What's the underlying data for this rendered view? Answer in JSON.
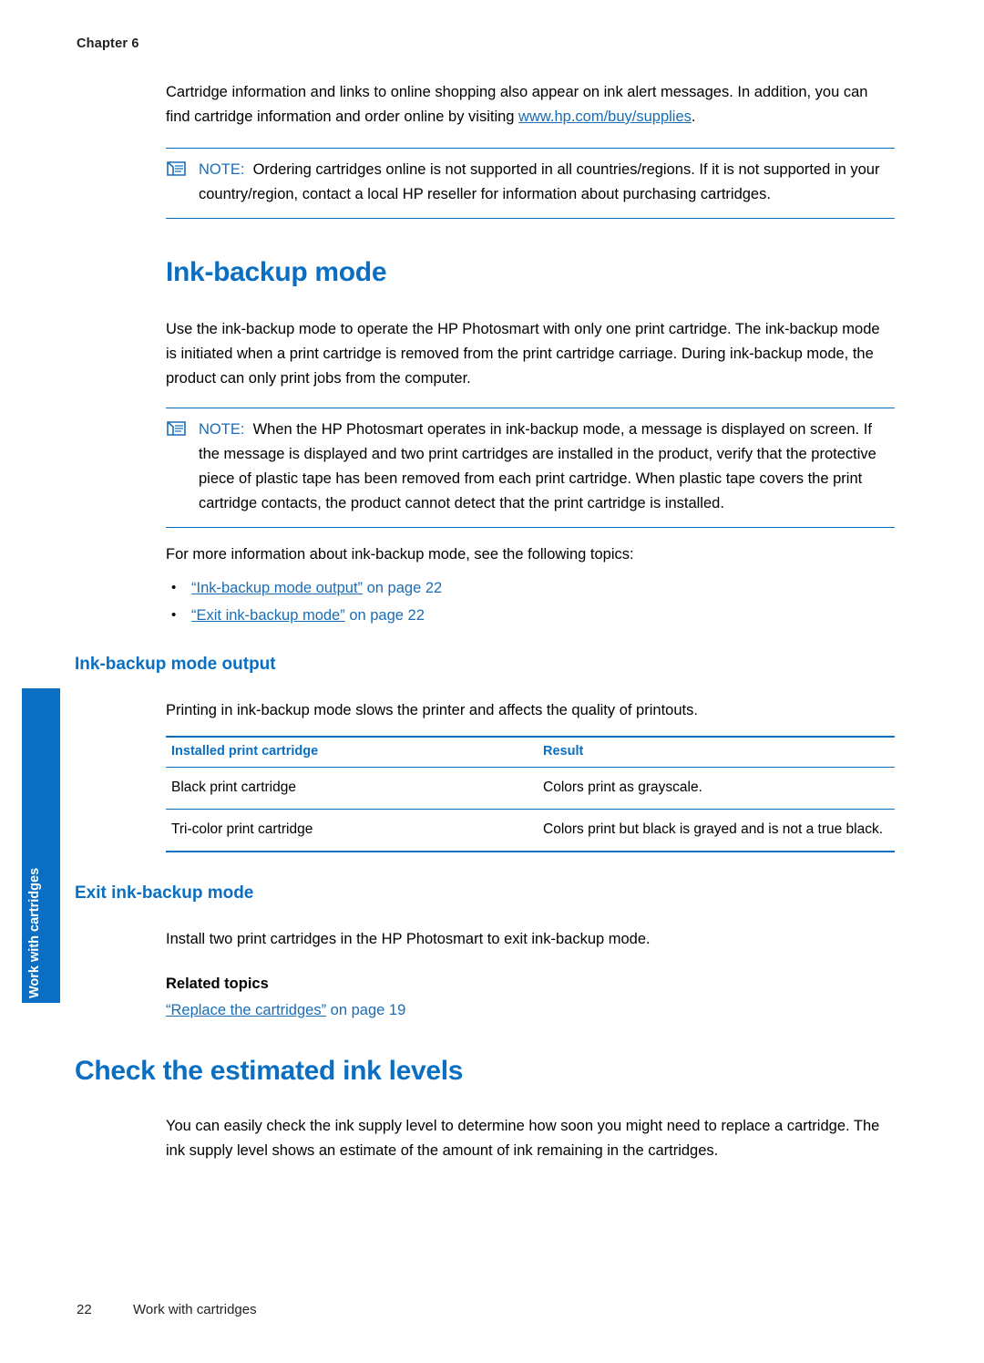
{
  "header": {
    "chapter_label": "Chapter 6"
  },
  "side_tab": {
    "label": "Work with cartridges",
    "color": "#0a6fc2"
  },
  "intro": {
    "paragraph_part1": "Cartridge information and links to online shopping also appear on ink alert messages. In addition, you can find cartridge information and order online by visiting ",
    "link_text": "www.hp.com/buy/supplies",
    "paragraph_part2": "."
  },
  "note1": {
    "keyword": "NOTE:",
    "text": "Ordering cartridges online is not supported in all countries/regions. If it is not supported in your country/region, contact a local HP reseller for information about purchasing cartridges."
  },
  "section1": {
    "title": "Ink-backup mode",
    "paragraph": "Use the ink-backup mode to operate the HP Photosmart with only one print cartridge. The ink-backup mode is initiated when a print cartridge is removed from the print cartridge carriage. During ink-backup mode, the product can only print jobs from the computer.",
    "note": {
      "keyword": "NOTE:",
      "text": "When the HP Photosmart operates in ink-backup mode, a message is displayed on screen. If the message is displayed and two print cartridges are installed in the product, verify that the protective piece of plastic tape has been removed from each print cartridge. When plastic tape covers the print cartridge contacts, the product cannot detect that the print cartridge is installed."
    },
    "more_info": "For more information about ink-backup mode, see the following topics:",
    "links": [
      {
        "quoted": "“Ink-backup mode output”",
        "suffix": " on page 22"
      },
      {
        "quoted": "“Exit ink-backup mode”",
        "suffix": " on page 22"
      }
    ]
  },
  "subsection_output": {
    "title": "Ink-backup mode output",
    "paragraph": "Printing in ink-backup mode slows the printer and affects the quality of printouts.",
    "table": {
      "headers": [
        "Installed print cartridge",
        "Result"
      ],
      "rows": [
        [
          "Black print cartridge",
          "Colors print as grayscale."
        ],
        [
          "Tri-color print cartridge",
          "Colors print but black is grayed and is not a true black."
        ]
      ]
    }
  },
  "subsection_exit": {
    "title": "Exit ink-backup mode",
    "paragraph": "Install two print cartridges in the HP Photosmart to exit ink-backup mode.",
    "related_topics_title": "Related topics",
    "related_link": {
      "quoted": "“Replace the cartridges”",
      "suffix": " on page 19"
    }
  },
  "section2": {
    "title": "Check the estimated ink levels",
    "paragraph": "You can easily check the ink supply level to determine how soon you might need to replace a cartridge. The ink supply level shows an estimate of the amount of ink remaining in the cartridges."
  },
  "footer": {
    "page_number": "22",
    "text": "Work with cartridges"
  }
}
